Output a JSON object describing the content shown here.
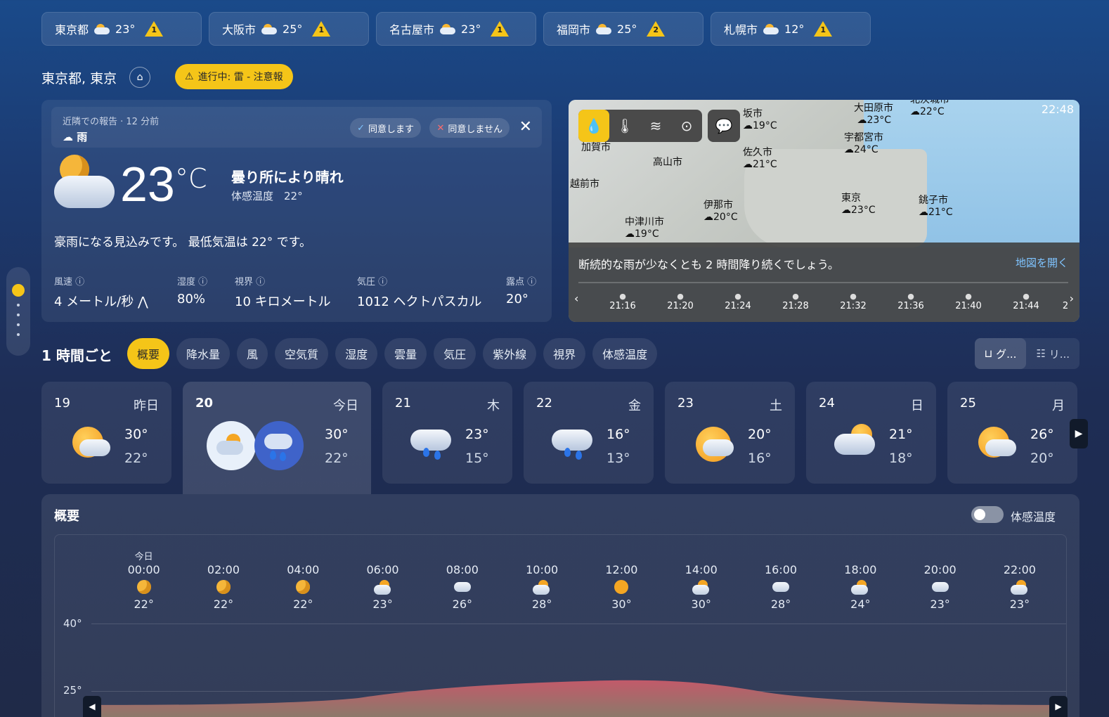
{
  "cities": [
    {
      "name": "東京都",
      "temp": "23°",
      "alerts": "1"
    },
    {
      "name": "大阪市",
      "temp": "25°",
      "alerts": "1"
    },
    {
      "name": "名古屋市",
      "temp": "23°",
      "alerts": "1"
    },
    {
      "name": "福岡市",
      "temp": "25°",
      "alerts": "2"
    },
    {
      "name": "札幌市",
      "temp": "12°",
      "alerts": "1"
    }
  ],
  "location": {
    "name": "東京都, 東京",
    "alert": "進行中: 雷 - 注意報"
  },
  "report": {
    "meta": "近隣での報告 · 12 分前",
    "condition": "雨",
    "agree": "同意します",
    "disagree": "同意しません"
  },
  "current": {
    "temp": "23",
    "unit": "°C",
    "condition": "曇り所により晴れ",
    "feels": "体感温度　22°",
    "summary": "豪雨になる見込みです。 最低気温は 22° です。",
    "stats": [
      {
        "label": "風速",
        "value": "4 メートル/秒"
      },
      {
        "label": "湿度",
        "value": "80%"
      },
      {
        "label": "視界",
        "value": "10 キロメートル"
      },
      {
        "label": "気圧",
        "value": "1012 ヘクトパスカル"
      },
      {
        "label": "露点",
        "value": "20°"
      }
    ]
  },
  "map": {
    "time": "22:48",
    "message": "断続的な雨が少なくとも 2 時間降り続くでしょう。",
    "open": "地図を開く",
    "places": [
      {
        "name": "坂市",
        "temp": "19°C"
      },
      {
        "name": "大田原市",
        "temp": "23°C"
      },
      {
        "name": "北茨城市",
        "temp": "22°C"
      },
      {
        "name": "加賀市",
        "temp": ""
      },
      {
        "name": "宇都宮市",
        "temp": "24°C"
      },
      {
        "name": "佐久市",
        "temp": "21°C"
      },
      {
        "name": "高山市",
        "temp": ""
      },
      {
        "name": "越前市",
        "temp": ""
      },
      {
        "name": "東京",
        "temp": "23°C"
      },
      {
        "name": "銚子市",
        "temp": "21°C"
      },
      {
        "name": "伊那市",
        "temp": "20°C"
      },
      {
        "name": "中津川市",
        "temp": "19°C"
      }
    ],
    "times": [
      "21:16",
      "21:20",
      "21:24",
      "21:28",
      "21:32",
      "21:36",
      "21:40",
      "21:44",
      "2"
    ]
  },
  "hourly": {
    "title": "1 時間ごと",
    "tabs": [
      "概要",
      "降水量",
      "風",
      "空気質",
      "湿度",
      "雲量",
      "気圧",
      "紫外線",
      "視界",
      "体感温度"
    ],
    "views": [
      "グ...",
      "リ..."
    ]
  },
  "days": [
    {
      "date": "19",
      "dow": "昨日",
      "hi": "30°",
      "lo": "22°",
      "icon": "sun-cloud"
    },
    {
      "date": "20",
      "dow": "今日",
      "hi": "30°",
      "lo": "22°",
      "icon": "cloud-rain"
    },
    {
      "date": "21",
      "dow": "木",
      "hi": "23°",
      "lo": "15°",
      "icon": "rain"
    },
    {
      "date": "22",
      "dow": "金",
      "hi": "16°",
      "lo": "13°",
      "icon": "rain"
    },
    {
      "date": "23",
      "dow": "土",
      "hi": "20°",
      "lo": "16°",
      "icon": "sun-cloud"
    },
    {
      "date": "24",
      "dow": "日",
      "hi": "21°",
      "lo": "18°",
      "icon": "cloud"
    },
    {
      "date": "25",
      "dow": "月",
      "hi": "26°",
      "lo": "20°",
      "icon": "sun-cloud"
    }
  ],
  "summary": {
    "title": "概要",
    "toggle": "体感温度",
    "hours": [
      {
        "label": "今日",
        "time": "00:00",
        "temp": "22°",
        "icon": "moon"
      },
      {
        "label": "",
        "time": "02:00",
        "temp": "22°",
        "icon": "moon"
      },
      {
        "label": "",
        "time": "04:00",
        "temp": "22°",
        "icon": "moon"
      },
      {
        "label": "",
        "time": "06:00",
        "temp": "23°",
        "icon": "sun-cloud"
      },
      {
        "label": "",
        "time": "08:00",
        "temp": "26°",
        "icon": "cloud"
      },
      {
        "label": "",
        "time": "10:00",
        "temp": "28°",
        "icon": "sun-cloud"
      },
      {
        "label": "",
        "time": "12:00",
        "temp": "30°",
        "icon": "sun"
      },
      {
        "label": "",
        "time": "14:00",
        "temp": "30°",
        "icon": "sun-cloud"
      },
      {
        "label": "",
        "time": "16:00",
        "temp": "28°",
        "icon": "cloud"
      },
      {
        "label": "",
        "time": "18:00",
        "temp": "24°",
        "icon": "sun-cloud"
      },
      {
        "label": "",
        "time": "20:00",
        "temp": "23°",
        "icon": "cloud"
      },
      {
        "label": "",
        "time": "22:00",
        "temp": "23°",
        "icon": "sun-cloud"
      }
    ],
    "yaxis": [
      "40°",
      "25°"
    ]
  }
}
